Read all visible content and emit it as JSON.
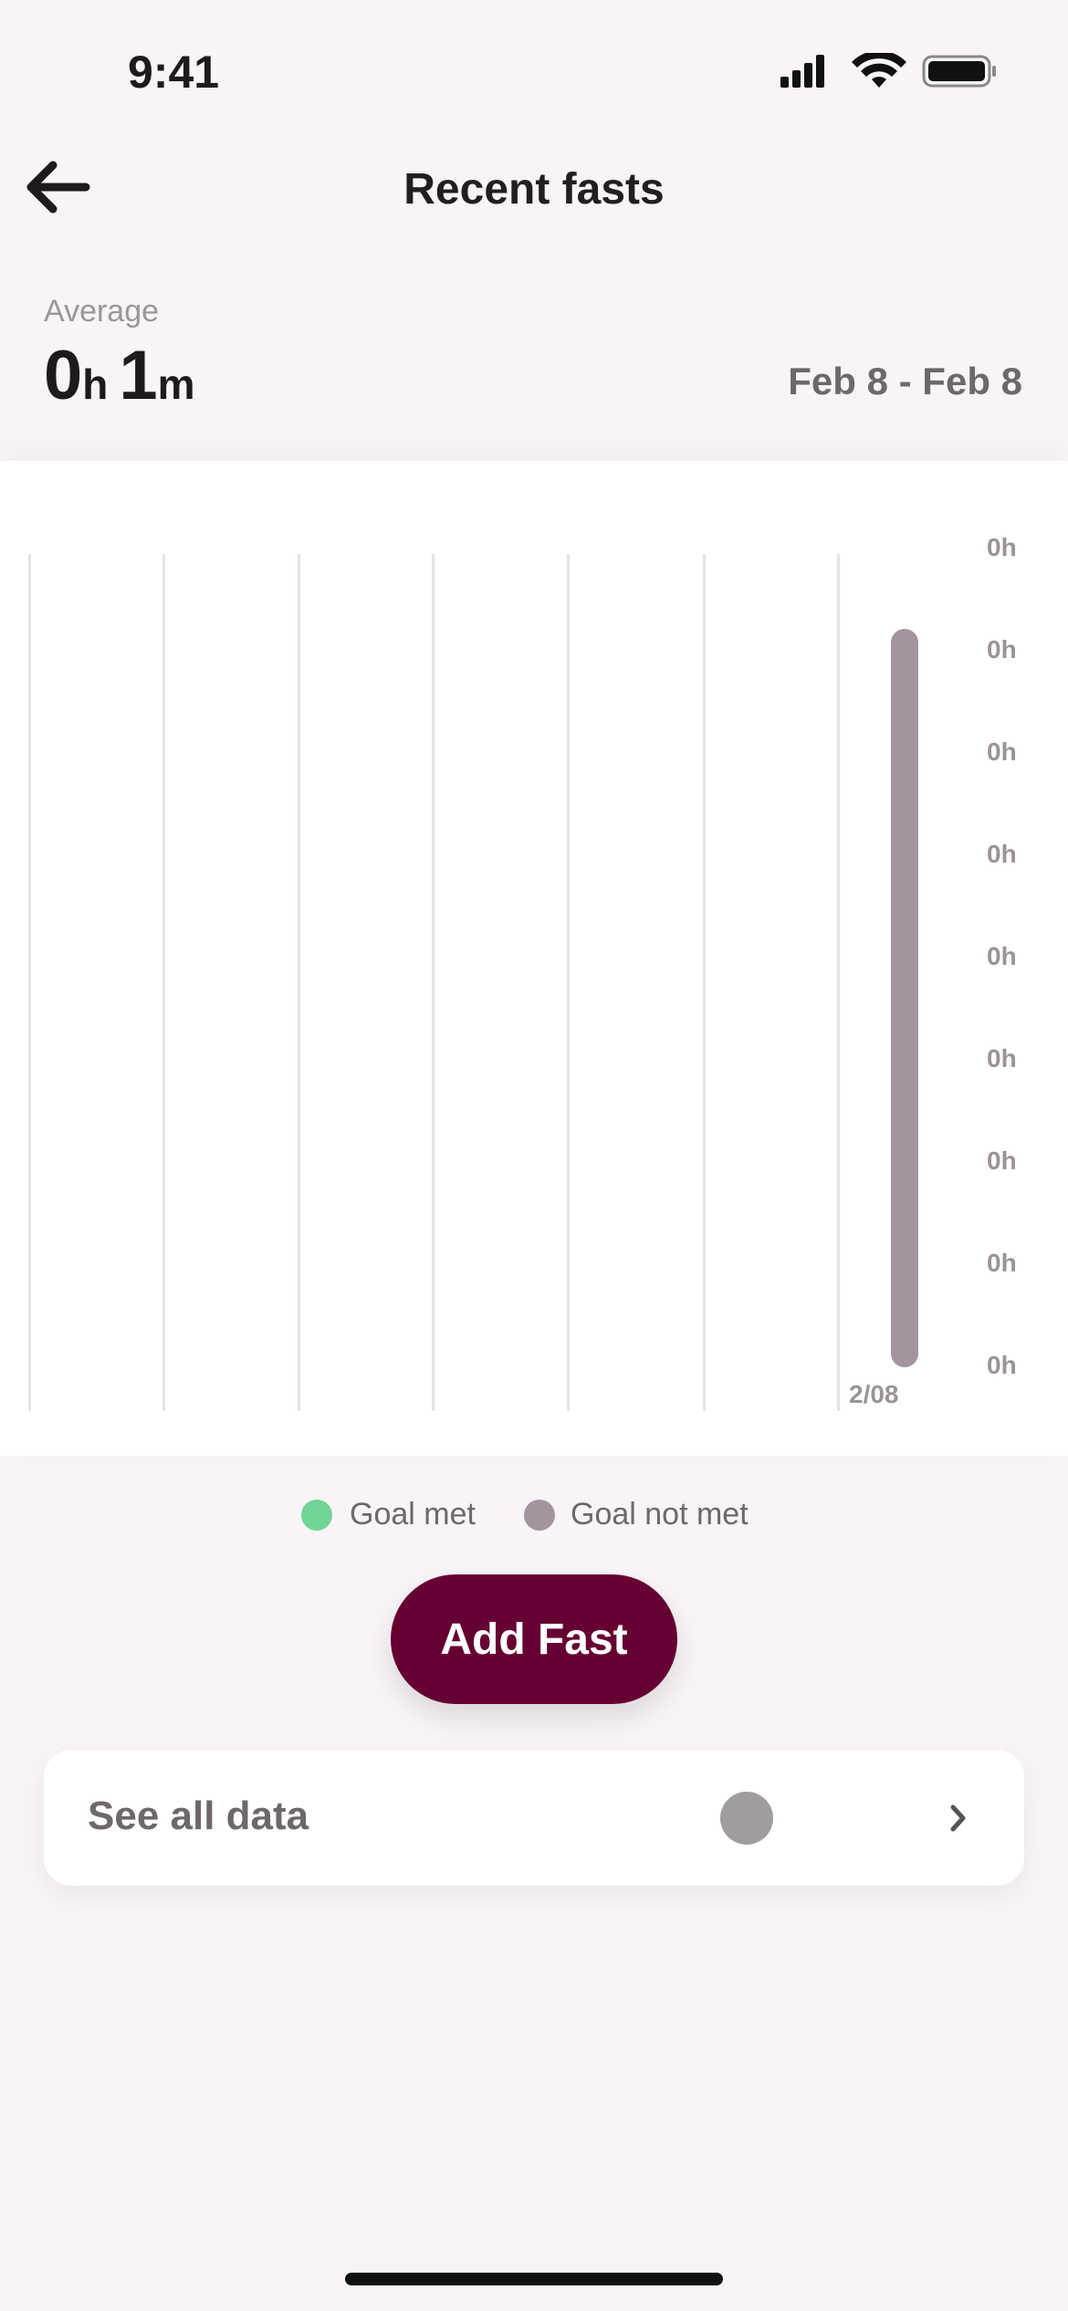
{
  "status_bar": {
    "time": "9:41"
  },
  "header": {
    "title": "Recent fasts",
    "back_icon": "arrow-left-icon"
  },
  "summary": {
    "label": "Average",
    "hours": "0",
    "hours_unit": "h",
    "minutes": "1",
    "minutes_unit": "m",
    "date_range": "Feb 8 - Feb 8"
  },
  "chart_data": {
    "type": "bar",
    "categories": [
      "2/08"
    ],
    "values": [
      0.02
    ],
    "y_tick_labels": [
      "0h",
      "0h",
      "0h",
      "0h",
      "0h",
      "0h",
      "0h",
      "0h",
      "0h"
    ],
    "grid": true,
    "bar_color": "#a3959e"
  },
  "legend": {
    "items": [
      {
        "label": "Goal met",
        "color": "#6fd495"
      },
      {
        "label": "Goal not met",
        "color": "#a3959e"
      }
    ]
  },
  "add_button": {
    "label": "Add Fast",
    "color": "#660033"
  },
  "see_all": {
    "label": "See all data"
  }
}
